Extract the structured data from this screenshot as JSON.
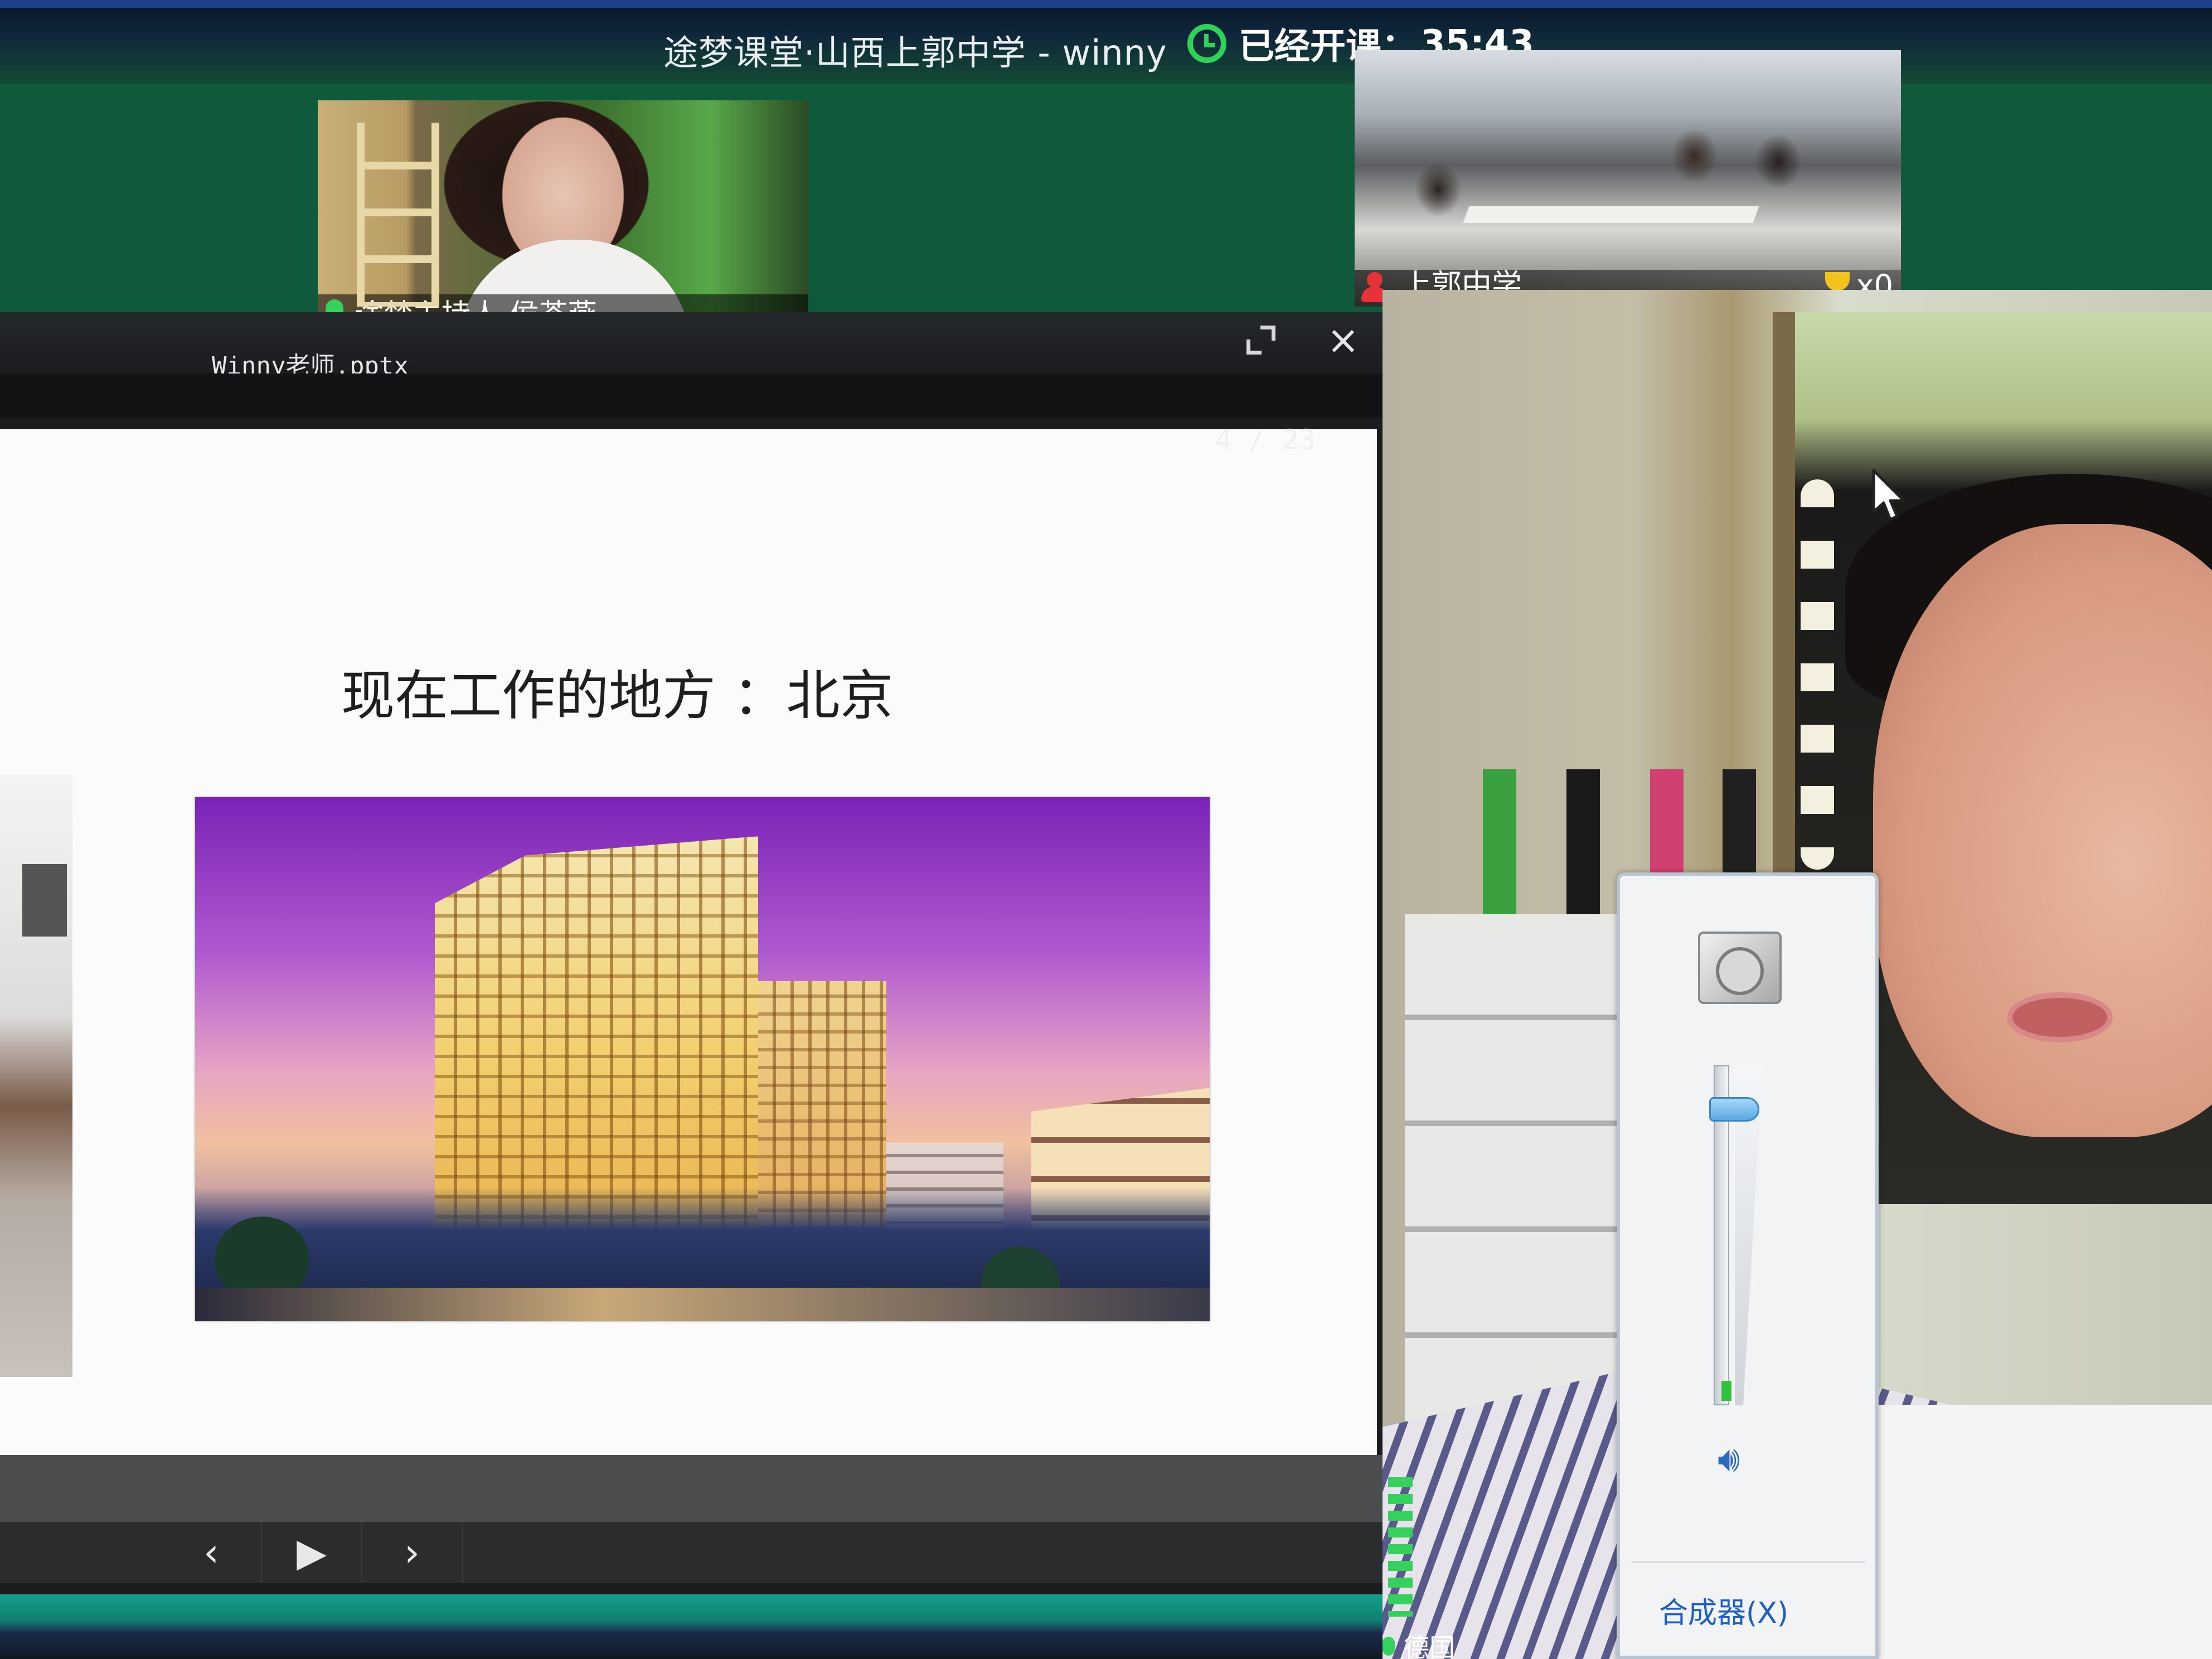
{
  "window": {
    "title": "途梦课堂·山西上郭中学 - winny",
    "timer_label": "已经开课：",
    "timer_value": "35:43"
  },
  "video_tiles": {
    "host": {
      "name": "途梦主持人-侯茶燕"
    },
    "school": {
      "name": "上郭中学",
      "trophy_count": "x0"
    }
  },
  "presentation": {
    "filename": "Winny老师.pptx",
    "slide_title": "现在工作的地方 ：北京",
    "page_current": 4,
    "page_total": 23,
    "page_counter": "4 / 23",
    "controls": {
      "prev": "‹",
      "play": "▶",
      "next": "›"
    }
  },
  "volume_popup": {
    "level": 0.9,
    "mixer_label": "合成器(X)"
  },
  "teacher_caption": "德国",
  "colors": {
    "accent_green": "#2fd35a",
    "title_bar_blue": "#1b3f8a",
    "link_blue": "#1f5fbf"
  }
}
